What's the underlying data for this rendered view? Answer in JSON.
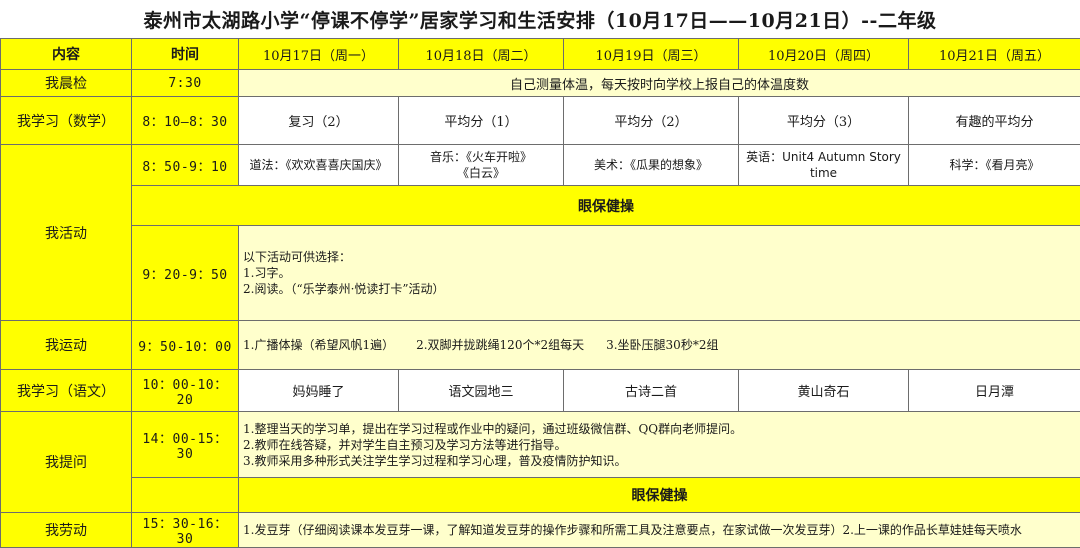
{
  "title": "泰州市太湖路小学“停课不停学”居家学习和生活安排（10月17日——10月21日）--二年级",
  "header": {
    "content": "内容",
    "time": "时间",
    "days": [
      "10月17日（周一）",
      "10月18日（周二）",
      "10月19日（周三）",
      "10月20日（周四）",
      "10月21日（周五）"
    ]
  },
  "morning_check": {
    "label": "我晨检",
    "time": "7:30",
    "text": "自己测量体温，每天按时向学校上报自己的体温度数"
  },
  "math": {
    "label": "我学习（数学）",
    "time": "8：10—8：30",
    "cells": [
      "复习（2）",
      "平均分（1）",
      "平均分（2）",
      "平均分（3）",
      "有趣的平均分"
    ]
  },
  "activity": {
    "label": "我活动",
    "time1": "8：50-9：10",
    "cells": [
      "道法：《欢欢喜喜庆国庆》",
      "音乐：《火车开啦》",
      "《白云》",
      "美术：《瓜果的想象》",
      "英语：Unit4 Autumn  Story time",
      "科学：《看月亮》"
    ],
    "band": "眼保健操",
    "time2": "9：20-9：50",
    "options": [
      "以下活动可供选择：",
      "1.习字。",
      "2.阅读。（“乐学泰州·悦读打卡”活动）"
    ]
  },
  "sport": {
    "label": "我运动",
    "time": "9：50-10：00",
    "items": [
      "1.广播体操（希望风帆1遍）",
      "2.双脚并拢跳绳120个*2组每天",
      "3.坐卧压腿30秒*2组"
    ]
  },
  "chinese": {
    "label": "我学习（语文）",
    "time": "10：00-10：20",
    "cells": [
      "妈妈睡了",
      "语文园地三",
      "古诗二首",
      "黄山奇石",
      "日月潭"
    ]
  },
  "question": {
    "label": "我提问",
    "time": "14：00-15：30",
    "items": [
      "1.整理当天的学习单，提出在学习过程或作业中的疑问，通过班级微信群、QQ群向老师提问。",
      "2.教师在线答疑，并对学生自主预习及学习方法等进行指导。",
      "3.教师采用多种形式关注学生学习过程和学习心理，普及疫情防护知识。"
    ],
    "band": "眼保健操"
  },
  "labor": {
    "label": "我劳动",
    "time": "15：30-16：30",
    "text": "1.发豆芽（仔细阅读课本发豆芽一课，了解知道发豆芽的操作步骤和所需工具及注意要点，在家试做一次发豆芽）2.上一课的作品长草娃娃每天喷水"
  },
  "colors": {
    "yellow": "#ffff00",
    "light_yellow": "#ffffcc",
    "border": "#6d6d6d"
  }
}
